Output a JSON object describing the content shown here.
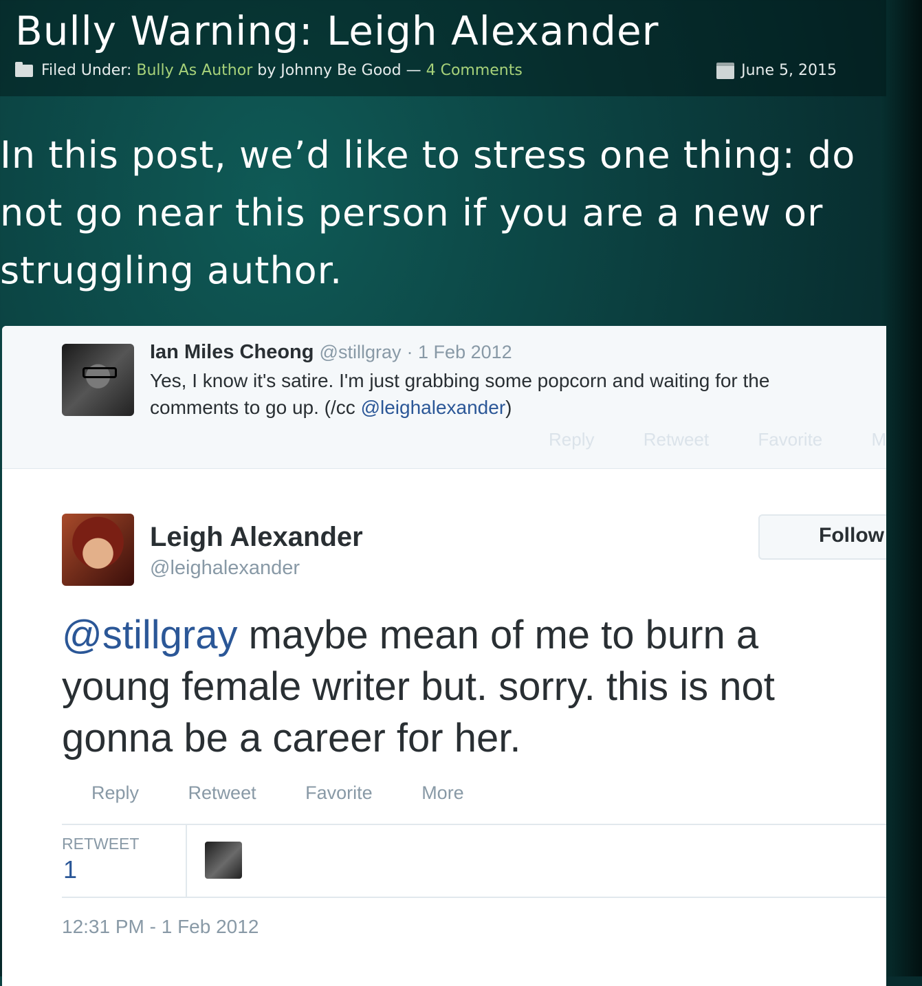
{
  "post": {
    "title": "Bully Warning: Leigh Alexander",
    "meta": {
      "filed_label": "Filed Under:",
      "category": "Bully As Author",
      "by_label": "by",
      "author": "Johnny Be Good",
      "separator": "—",
      "comments": "4 Comments",
      "date": "June 5, 2015"
    },
    "intro": "In this post, we’d like to stress one thing: do not go near this person if you are a new or struggling author."
  },
  "parent_tweet": {
    "name": "Ian Miles Cheong",
    "handle": "@stillgray",
    "time": "· 1 Feb 2012",
    "text_before": "Yes, I know it's satire. I'm just grabbing some popcorn and waiting for the comments to go up. (/cc ",
    "mention": "@leighalexander",
    "text_after": ")",
    "actions": [
      "Reply",
      "Retweet",
      "Favorite",
      "Mo"
    ]
  },
  "main_tweet": {
    "name": "Leigh Alexander",
    "handle": "@leighalexander",
    "follow_label": "Follow",
    "mention": "@stillgray",
    "text": " maybe mean of me to burn a young female writer but. sorry. this is not gonna be a career for her.",
    "actions": [
      "Reply",
      "Retweet",
      "Favorite",
      "More"
    ],
    "retweet_label": "RETWEET",
    "retweet_count": "1",
    "timestamp": "12:31 PM - 1 Feb 2012"
  }
}
